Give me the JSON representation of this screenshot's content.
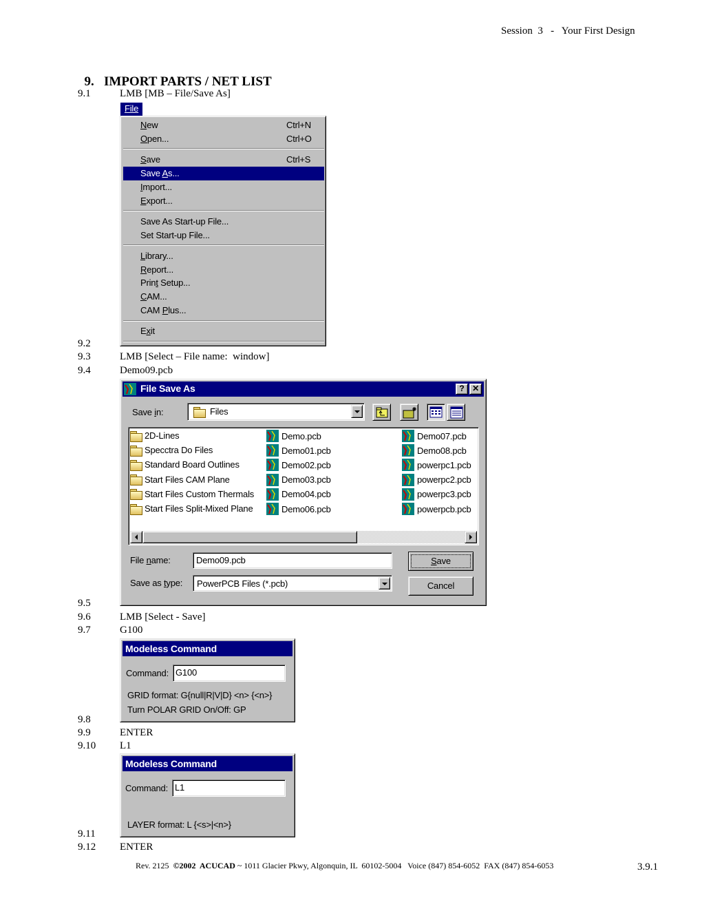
{
  "header": {
    "session": "Session  3   -   Your First Design"
  },
  "section": {
    "number": "9.",
    "title": "IMPORT PARTS / NET LIST"
  },
  "steps": [
    {
      "num": "9.1",
      "text": "LMB [MB – File/Save As]"
    },
    {
      "num": "9.2",
      "text": ""
    },
    {
      "num": "9.3",
      "text": "LMB [Select – File name:  window]"
    },
    {
      "num": "9.4",
      "text": "Demo09.pcb"
    },
    {
      "num": "9.5",
      "text": ""
    },
    {
      "num": "9.6",
      "text": "LMB [Select - Save]"
    },
    {
      "num": "9.7",
      "text": "G100"
    },
    {
      "num": "9.8",
      "text": ""
    },
    {
      "num": "9.9",
      "text": "ENTER"
    },
    {
      "num": "9.10",
      "text": "L1"
    },
    {
      "num": "9.11",
      "text": ""
    },
    {
      "num": "9.12",
      "text": "ENTER"
    }
  ],
  "file_menu": {
    "title": "File",
    "items": [
      {
        "pre": "",
        "u": "N",
        "post": "ew",
        "shortcut": "Ctrl+N"
      },
      {
        "pre": "",
        "u": "O",
        "post": "pen...",
        "shortcut": "Ctrl+O"
      },
      {
        "pre": "",
        "u": "S",
        "post": "ave",
        "shortcut": "Ctrl+S"
      },
      {
        "pre": "Save ",
        "u": "A",
        "post": "s...",
        "shortcut": "",
        "selected": true
      },
      {
        "pre": "",
        "u": "I",
        "post": "mport...",
        "shortcut": ""
      },
      {
        "pre": "",
        "u": "E",
        "post": "xport...",
        "shortcut": ""
      },
      {
        "pre": "Save As Start-up File...",
        "u": "",
        "post": "",
        "shortcut": ""
      },
      {
        "pre": "Set Start-up File...",
        "u": "",
        "post": "",
        "shortcut": ""
      },
      {
        "pre": "",
        "u": "L",
        "post": "ibrary...",
        "shortcut": ""
      },
      {
        "pre": "",
        "u": "R",
        "post": "eport...",
        "shortcut": ""
      },
      {
        "pre": "Prin",
        "u": "t",
        "post": " Setup...",
        "shortcut": ""
      },
      {
        "pre": "",
        "u": "C",
        "post": "AM...",
        "shortcut": ""
      },
      {
        "pre": "CAM ",
        "u": "P",
        "post": "lus...",
        "shortcut": ""
      },
      {
        "pre": "E",
        "u": "x",
        "post": "it",
        "shortcut": ""
      }
    ]
  },
  "save_dialog": {
    "title": "File Save As",
    "help_label": "?",
    "close_label": "✕",
    "save_in_label_pre": "Save ",
    "save_in_label_u": "i",
    "save_in_label_post": "n:",
    "save_in_value": "Files",
    "folders": [
      "2D-Lines",
      "Specctra Do Files",
      "Standard Board Outlines",
      "Start Files CAM Plane",
      "Start Files Custom Thermals",
      "Start Files Split-Mixed Plane"
    ],
    "files_col2": [
      "Demo.pcb",
      "Demo01.pcb",
      "Demo02.pcb",
      "Demo03.pcb",
      "Demo04.pcb",
      "Demo06.pcb"
    ],
    "files_col3": [
      "Demo07.pcb",
      "Demo08.pcb",
      "powerpc1.pcb",
      "powerpc2.pcb",
      "powerpc3.pcb",
      "powerpcb.pcb"
    ],
    "file_name_label_pre": "File ",
    "file_name_label_u": "n",
    "file_name_label_post": "ame:",
    "file_name_value": "Demo09.pcb",
    "type_label_pre": "Save as ",
    "type_label_u": "t",
    "type_label_post": "ype:",
    "type_value": "PowerPCB Files (*.pcb)",
    "save_button_u": "S",
    "save_button_post": "ave",
    "cancel_button": "Cancel"
  },
  "modeless_1": {
    "title": "Modeless Command",
    "command_label": "Command:",
    "command_value": "G100",
    "help_lines": [
      "GRID format: G{null|R|V|D} <n> {<n>}",
      "Turn POLAR GRID On/Off: GP"
    ]
  },
  "modeless_2": {
    "title": "Modeless Command",
    "command_label": "Command:",
    "command_value": "L1",
    "help_lines": [
      "LAYER format: L {<s>|<n>}"
    ]
  },
  "footer": {
    "rev": "Rev. 2125  ",
    "copyright": "©2002  ACUCAD",
    "address": " ~ 1011 Glacier Pkwy, Algonquin, IL  60102-5004   Voice (847) 854-6052  FAX (847) 854-6053",
    "page": "3.9.1"
  }
}
